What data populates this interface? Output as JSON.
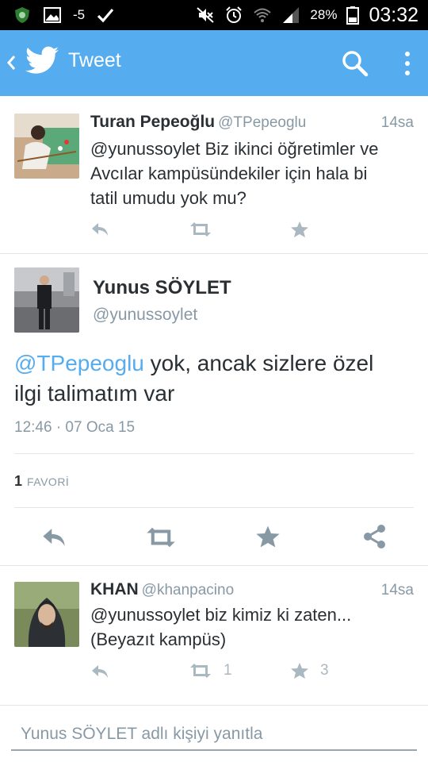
{
  "status_bar": {
    "notification_count": "-5",
    "battery_percent": "28%",
    "clock": "03:32"
  },
  "app_bar": {
    "title": "Tweet"
  },
  "tweets_before": [
    {
      "name": "Turan Pepeoğlu",
      "handle": "@TPepeoglu",
      "time": "14sa",
      "lines": [
        "@yunussoylet  Biz ikinci öğretimler ve",
        "Avcılar kampüsündekiler için hala bi",
        "tatil umudu yok mu?"
      ]
    }
  ],
  "main_tweet": {
    "name": "Yunus SÖYLET",
    "handle": "@yunussoylet",
    "mention": "@TPepeoglu",
    "text_line1": " yok, ancak sizlere özel",
    "text_line2": "ilgi talimatım var",
    "datetime": "12:46 · 07 Oca 15",
    "favorites_count": "1",
    "favorites_label": "FAVORİ"
  },
  "tweets_after": [
    {
      "name": "KHAN",
      "handle": "@khanpacino",
      "time": "14sa",
      "lines": [
        "@yunussoylet biz kimiz ki zaten...",
        "(Beyazıt kampüs)"
      ],
      "retweets": "1",
      "favorites": "3"
    }
  ],
  "reply": {
    "placeholder": "Yunus SÖYLET adlı kişiyi yanıtla"
  },
  "colors": {
    "twitter_blue": "#55acee",
    "text": "#292f33",
    "muted": "#8899a6",
    "icon_gray": "#aab8c2",
    "action_gray": "#8899a6"
  }
}
